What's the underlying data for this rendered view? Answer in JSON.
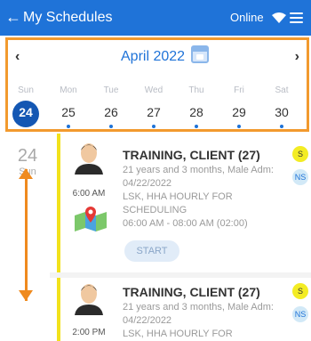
{
  "header": {
    "back_glyph": "←",
    "title": "My Schedules",
    "status": "Online",
    "wifi_icon": "wifi-icon",
    "menu_icon": "hamburger-menu-icon"
  },
  "calendar": {
    "prev_glyph": "‹",
    "next_glyph": "›",
    "month": "April 2022",
    "days": [
      {
        "name": "Sun",
        "num": "24",
        "selected": true
      },
      {
        "name": "Mon",
        "num": "25"
      },
      {
        "name": "Tue",
        "num": "26"
      },
      {
        "name": "Wed",
        "num": "27"
      },
      {
        "name": "Thu",
        "num": "28"
      },
      {
        "name": "Fri",
        "num": "29"
      },
      {
        "name": "Sat",
        "num": "30"
      }
    ]
  },
  "date_group": {
    "day": "24",
    "weekday": "Sun"
  },
  "visits": [
    {
      "time": "6:00 AM",
      "title": "TRAINING, CLIENT (27)",
      "line1": "21 years and 3 months, Male Adm:",
      "line2": "04/22/2022",
      "line3": "LSK, HHA HOURLY FOR",
      "line4": "SCHEDULING",
      "line5": "06:00 AM - 08:00 AM (02:00)",
      "action": "START",
      "badge1": "S",
      "badge2": "NS"
    },
    {
      "time": "2:00 PM",
      "title": "TRAINING, CLIENT (27)",
      "line1": "21 years and 3 months, Male Adm:",
      "line2": "04/22/2022",
      "line3": "LSK, HHA HOURLY FOR",
      "badge1": "S",
      "badge2": "NS"
    }
  ],
  "colors": {
    "header": "#1f73d8",
    "highlight": "#f29a2e",
    "accent_bar": "#f2e21c",
    "selected_day": "#1457b3"
  }
}
